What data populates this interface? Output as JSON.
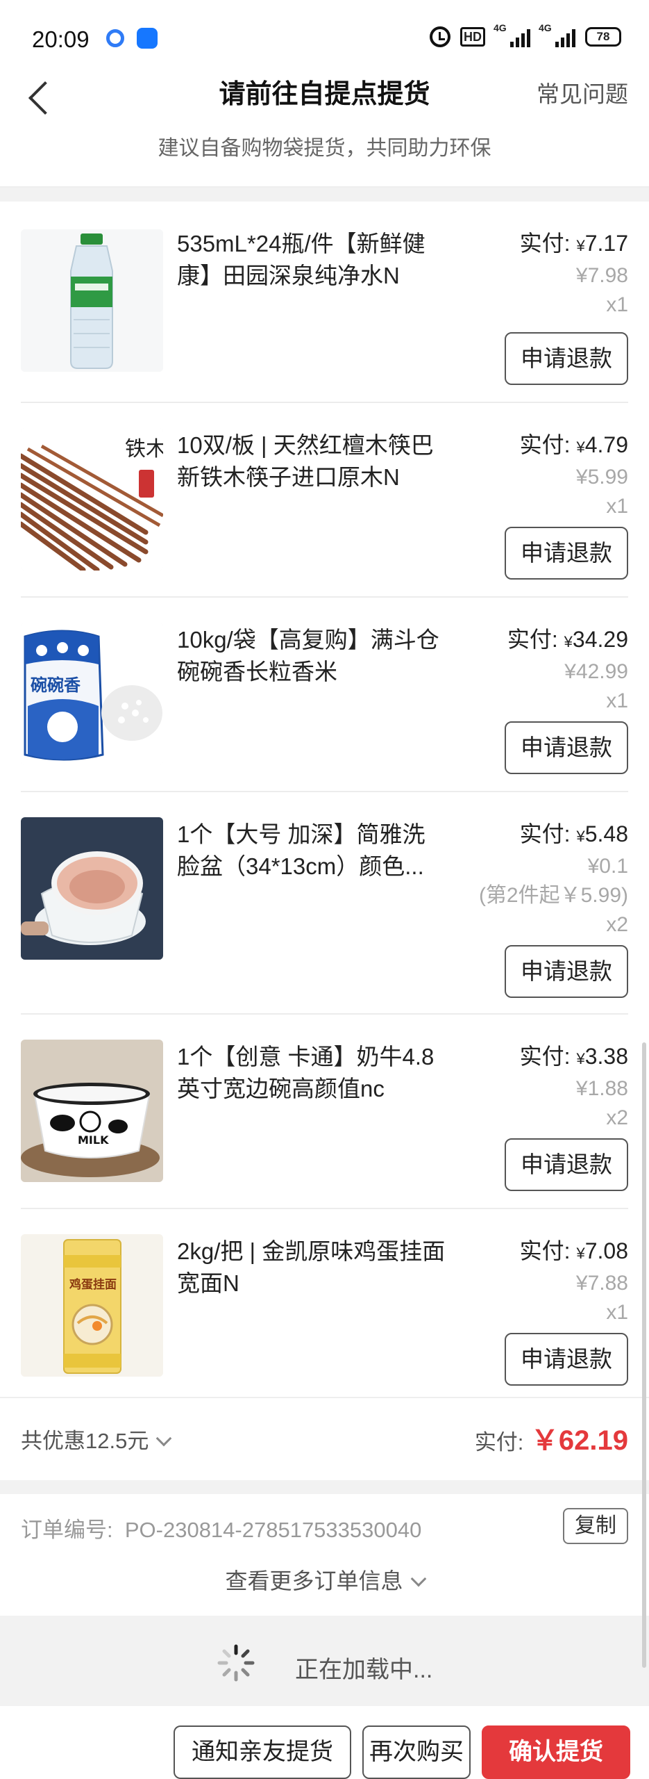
{
  "status_bar": {
    "time": "20:09",
    "hd": "HD",
    "net1": "4G",
    "net2": "4G",
    "battery": "78"
  },
  "header": {
    "title": "请前往自提点提货",
    "faq": "常见问题",
    "tip": "建议自备购物袋提货，共同助力环保"
  },
  "items": [
    {
      "name": "535mL*24瓶/件【新鲜健康】田园深泉纯净水N",
      "paid_label": "实付:",
      "currency": "¥",
      "paid": "7.17",
      "original": "¥7.98",
      "note": "",
      "qty": "x1",
      "refund": "申请退款",
      "thumb": "water-bottle"
    },
    {
      "name": "10双/板 | 天然红檀木筷巴新铁木筷子进口原木N",
      "paid_label": "实付:",
      "currency": "¥",
      "paid": "4.79",
      "original": "¥5.99",
      "note": "",
      "qty": "x1",
      "refund": "申请退款",
      "thumb": "chopsticks",
      "thumb_text": "铁木筷"
    },
    {
      "name": "10kg/袋【高复购】满斗仓碗碗香长粒香米",
      "paid_label": "实付:",
      "currency": "¥",
      "paid": "34.29",
      "original": "¥42.99",
      "note": "",
      "qty": "x1",
      "refund": "申请退款",
      "thumb": "rice-bag",
      "thumb_text": "碗碗香"
    },
    {
      "name": "1个【大号 加深】简雅洗脸盆（34*13cm）颜色...",
      "paid_label": "实付:",
      "currency": "¥",
      "paid": "5.48",
      "original": "¥0.1",
      "note": "(第2件起￥5.99)",
      "qty": "x2",
      "refund": "申请退款",
      "thumb": "wash-basin"
    },
    {
      "name": "1个【创意 卡通】奶牛4.8英寸宽边碗高颜值nc",
      "paid_label": "实付:",
      "currency": "¥",
      "paid": "3.38",
      "original": "¥1.88",
      "note": "",
      "qty": "x2",
      "refund": "申请退款",
      "thumb": "cow-bowl",
      "thumb_text": "MILK"
    },
    {
      "name": "2kg/把 | 金凯原味鸡蛋挂面宽面N",
      "paid_label": "实付:",
      "currency": "¥",
      "paid": "7.08",
      "original": "¥7.88",
      "note": "",
      "qty": "x1",
      "refund": "申请退款",
      "thumb": "noodles",
      "thumb_text": "鸡蛋挂面"
    }
  ],
  "summary": {
    "discount": "共优惠12.5元",
    "total_label": "实付:",
    "total": "￥62.19"
  },
  "order": {
    "number_label": "订单编号:",
    "number": "PO-230814-278517533530040",
    "copy": "复制",
    "more": "查看更多订单信息"
  },
  "loading": {
    "text": "正在加载中..."
  },
  "bottom": {
    "notify": "通知亲友提货",
    "rebuy": "再次购买",
    "confirm": "确认提货"
  },
  "colors": {
    "accent": "#e4393c",
    "text": "#222222",
    "muted": "#a8a8a8"
  }
}
